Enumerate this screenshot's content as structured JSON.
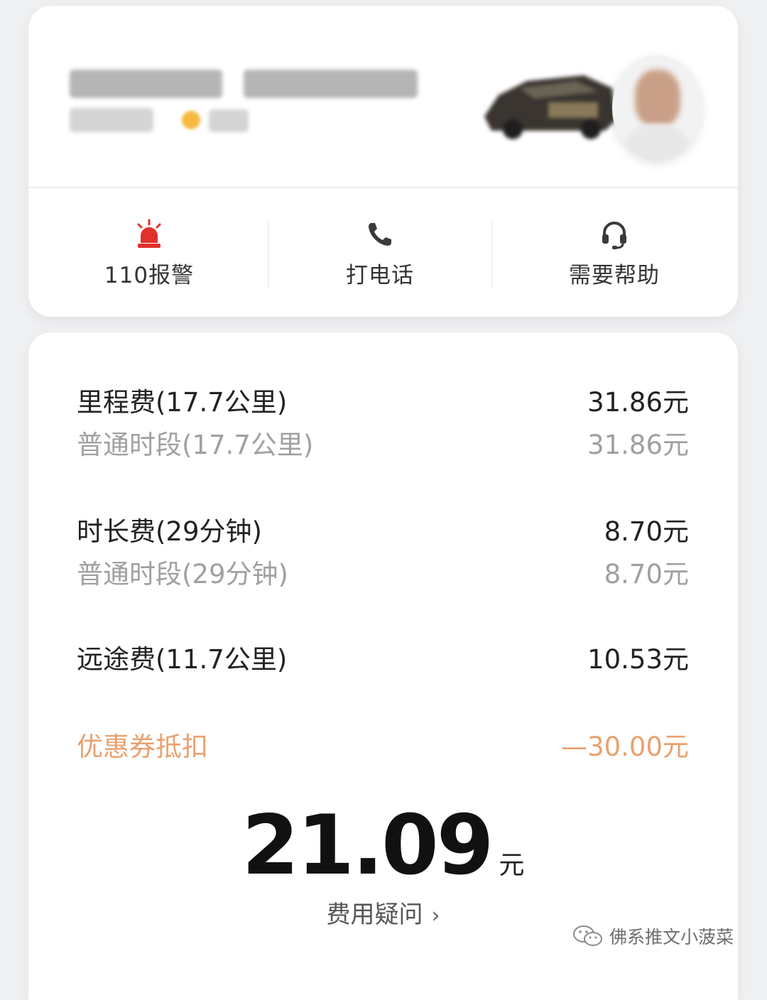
{
  "actions": {
    "police": "110报警",
    "call": "打电话",
    "help": "需要帮助"
  },
  "fees": {
    "mileage": {
      "label": "里程费(17.7公里)",
      "amount": "31.86元"
    },
    "mileage_sub": {
      "label": "普通时段(17.7公里)",
      "amount": "31.86元"
    },
    "duration": {
      "label": "时长费(29分钟)",
      "amount": "8.70元"
    },
    "duration_sub": {
      "label": "普通时段(29分钟)",
      "amount": "8.70元"
    },
    "longdistance": {
      "label": "远途费(11.7公里)",
      "amount": "10.53元"
    },
    "coupon": {
      "label": "优惠券抵扣",
      "amount": "—30.00元"
    }
  },
  "total": {
    "value": "21.09",
    "unit": "元"
  },
  "fee_question": "费用疑问",
  "watermark": "佛系推文小菠菜",
  "colors": {
    "alarm_red": "#e0312b",
    "discount_orange": "#e8a16f",
    "primary_text": "#222222",
    "secondary_text": "#a0a0a0"
  },
  "icons": {
    "police": "siren-icon",
    "call": "phone-icon",
    "help": "headset-icon",
    "chevron": "chevron-right-icon",
    "watermark": "wechat-logo-icon"
  }
}
